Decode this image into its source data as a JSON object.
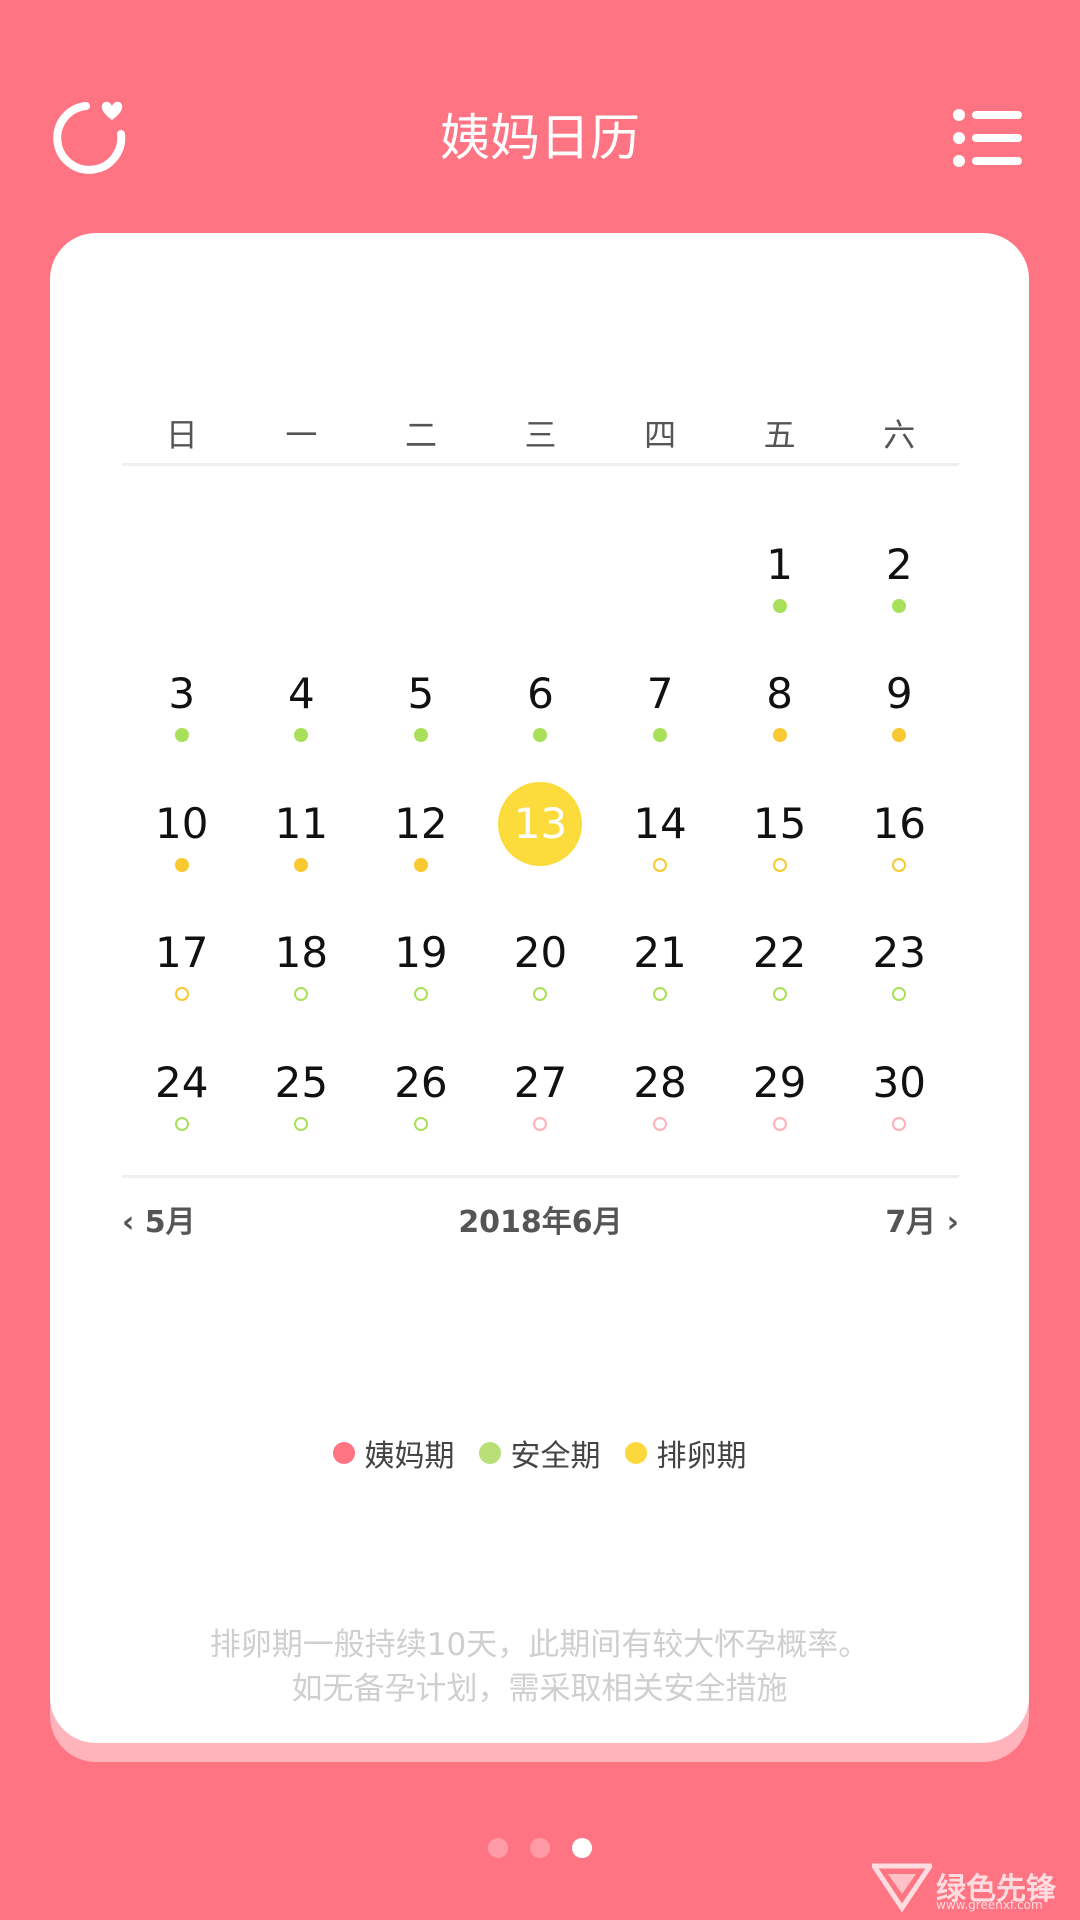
{
  "header": {
    "title": "姨妈日历",
    "left_icon": "refresh-heart-icon",
    "right_icon": "list-menu-icon"
  },
  "calendar": {
    "weekdays": [
      "日",
      "一",
      "二",
      "三",
      "四",
      "五",
      "六"
    ],
    "month_label": "2018年6月",
    "prev_label": "‹ 5月",
    "next_label": "7月 ›",
    "today": "13",
    "days": [
      {
        "num": "",
        "status": null,
        "filled": true
      },
      {
        "num": "",
        "status": null,
        "filled": true
      },
      {
        "num": "",
        "status": null,
        "filled": true
      },
      {
        "num": "",
        "status": null,
        "filled": true
      },
      {
        "num": "",
        "status": null,
        "filled": true
      },
      {
        "num": "1",
        "status": "safe",
        "filled": true
      },
      {
        "num": "2",
        "status": "safe",
        "filled": true
      },
      {
        "num": "3",
        "status": "safe",
        "filled": true
      },
      {
        "num": "4",
        "status": "safe",
        "filled": true
      },
      {
        "num": "5",
        "status": "safe",
        "filled": true
      },
      {
        "num": "6",
        "status": "safe",
        "filled": true
      },
      {
        "num": "7",
        "status": "safe",
        "filled": true
      },
      {
        "num": "8",
        "status": "ovulation",
        "filled": true
      },
      {
        "num": "9",
        "status": "ovulation",
        "filled": true
      },
      {
        "num": "10",
        "status": "ovulation",
        "filled": true
      },
      {
        "num": "11",
        "status": "ovulation",
        "filled": true
      },
      {
        "num": "12",
        "status": "ovulation",
        "filled": true
      },
      {
        "num": "13",
        "status": null,
        "filled": true
      },
      {
        "num": "14",
        "status": "ovulation",
        "filled": false
      },
      {
        "num": "15",
        "status": "ovulation",
        "filled": false
      },
      {
        "num": "16",
        "status": "ovulation",
        "filled": false
      },
      {
        "num": "17",
        "status": "ovulation",
        "filled": false
      },
      {
        "num": "18",
        "status": "safe",
        "filled": false
      },
      {
        "num": "19",
        "status": "safe",
        "filled": false
      },
      {
        "num": "20",
        "status": "safe",
        "filled": false
      },
      {
        "num": "21",
        "status": "safe",
        "filled": false
      },
      {
        "num": "22",
        "status": "safe",
        "filled": false
      },
      {
        "num": "23",
        "status": "safe",
        "filled": false
      },
      {
        "num": "24",
        "status": "safe",
        "filled": false
      },
      {
        "num": "25",
        "status": "safe",
        "filled": false
      },
      {
        "num": "26",
        "status": "safe",
        "filled": false
      },
      {
        "num": "27",
        "status": "period",
        "filled": false
      },
      {
        "num": "28",
        "status": "period",
        "filled": false
      },
      {
        "num": "29",
        "status": "period",
        "filled": false
      },
      {
        "num": "30",
        "status": "period",
        "filled": false
      }
    ]
  },
  "legend": [
    {
      "label": "姨妈期",
      "color": "#ff7482"
    },
    {
      "label": "安全期",
      "color": "#b8df78"
    },
    {
      "label": "排卵期",
      "color": "#fcd83c"
    }
  ],
  "colors": {
    "background": "#ff7482",
    "safe": "#a8e05a",
    "ovulation": "#f8c930",
    "period": "#ffb0bc",
    "today": "#fcdc3c"
  },
  "note": {
    "line1": "排卵期一般持续10天，此期间有较大怀孕概率。",
    "line2": "如无备孕计划，需采取相关安全措施"
  },
  "pager": {
    "count": 3,
    "active": 2
  },
  "watermark": {
    "text": "绿色先锋",
    "url": "www.greenxf.com"
  }
}
